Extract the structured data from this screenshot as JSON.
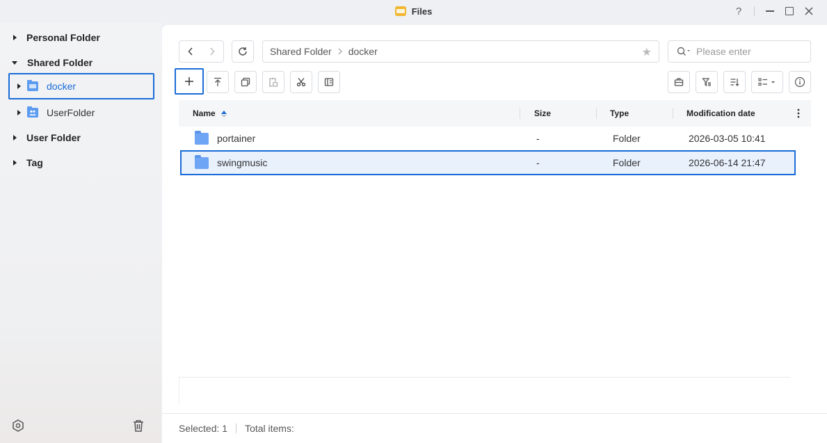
{
  "window": {
    "title": "Files",
    "help_label": "?"
  },
  "sidebar": {
    "items": [
      {
        "label": "Personal Folder",
        "level": 0,
        "expanded": false
      },
      {
        "label": "Shared Folder",
        "level": 0,
        "expanded": true
      },
      {
        "label": "docker",
        "level": 1,
        "selected": true,
        "icon": "shared-folder-icon"
      },
      {
        "label": "UserFolder",
        "level": 1,
        "icon": "user-folder-icon"
      },
      {
        "label": "User Folder",
        "level": 0,
        "expanded": false
      },
      {
        "label": "Tag",
        "level": 0,
        "expanded": false
      }
    ]
  },
  "toolbar": {
    "breadcrumb": [
      "Shared Folder",
      "docker"
    ],
    "search_placeholder": "Please enter",
    "search_value": ""
  },
  "table": {
    "columns": [
      "Name",
      "Size",
      "Type",
      "Modification date"
    ],
    "rows": [
      {
        "name": "portainer",
        "size": "-",
        "type": "Folder",
        "modified": "2026-03-05 10:41",
        "selected": false
      },
      {
        "name": "swingmusic",
        "size": "-",
        "type": "Folder",
        "modified": "2026-06-14 21:47",
        "selected": true
      }
    ]
  },
  "status": {
    "selected_label": "Selected: 1",
    "total_label": "Total items:"
  },
  "colors": {
    "accent": "#1a6bd8",
    "folder": "#6ea6f5",
    "selected_row_bg": "#e9f1fd"
  }
}
